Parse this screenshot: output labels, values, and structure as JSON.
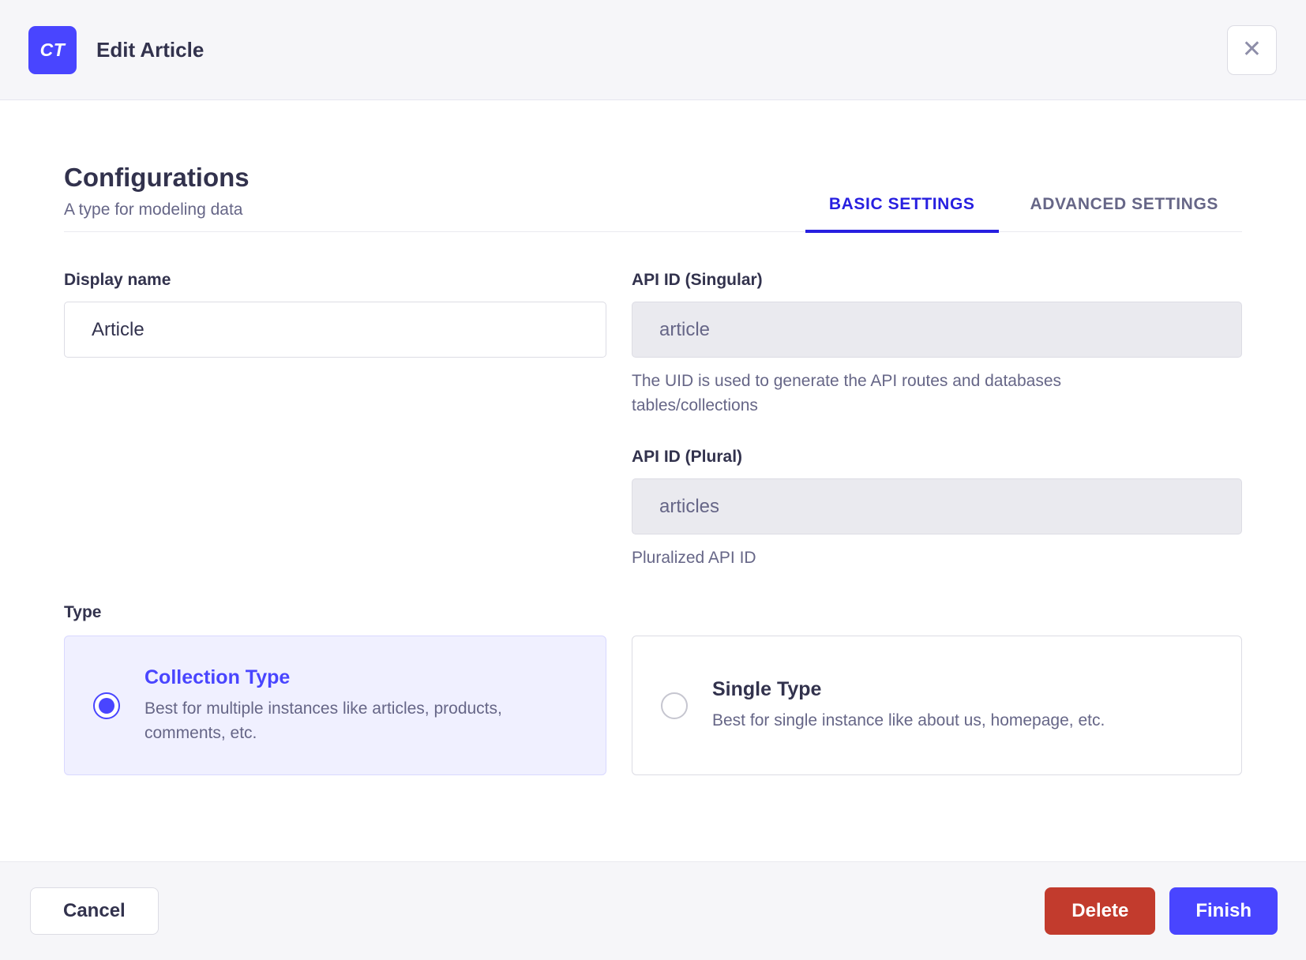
{
  "header": {
    "badge": "CT",
    "title": "Edit Article",
    "close_icon": "✕"
  },
  "intro": {
    "title": "Configurations",
    "subtitle": "A type for modeling data",
    "tabs": [
      {
        "label": "BASIC SETTINGS",
        "active": true
      },
      {
        "label": "ADVANCED SETTINGS",
        "active": false
      }
    ]
  },
  "form": {
    "display_name": {
      "label": "Display name",
      "value": "Article"
    },
    "api_id_singular": {
      "label": "API ID (Singular)",
      "value": "article",
      "hint": "The UID is used to generate the API routes and databases tables/collections"
    },
    "api_id_plural": {
      "label": "API ID (Plural)",
      "value": "articles",
      "hint": "Pluralized API ID"
    },
    "type": {
      "label": "Type",
      "options": [
        {
          "title": "Collection Type",
          "description": "Best for multiple instances like articles, products, comments, etc.",
          "selected": true
        },
        {
          "title": "Single Type",
          "description": "Best for single instance like about us, homepage, etc.",
          "selected": false
        }
      ]
    }
  },
  "footer": {
    "cancel_label": "Cancel",
    "delete_label": "Delete",
    "finish_label": "Finish"
  },
  "colors": {
    "primary": "#4945ff",
    "tab_active": "#271fe0",
    "danger": "#c23b2d",
    "text_dark": "#32324d",
    "text_gray": "#666687",
    "surface_gray": "#f6f6f9",
    "border": "#dcdce4",
    "selected_card_bg": "#f0f0ff"
  }
}
